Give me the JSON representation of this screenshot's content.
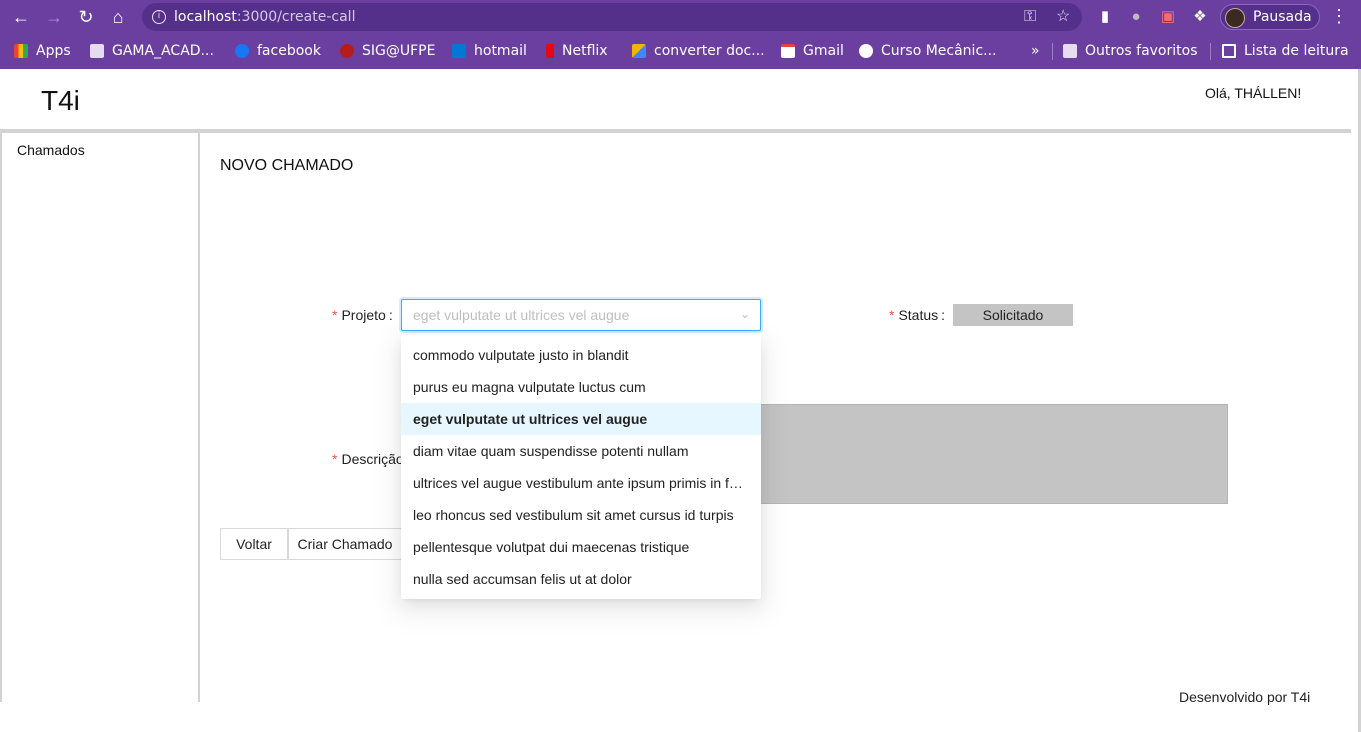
{
  "browser": {
    "url_host": "localhost",
    "url_path": ":3000/create-call",
    "profile_label": "Pausada",
    "bookmarks": [
      {
        "label": "Apps",
        "icon": "apps-grid-icon",
        "color": "#ea4335"
      },
      {
        "label": "GAMA_ACAD...",
        "icon": "folder-icon",
        "color": "#e6dcf2"
      },
      {
        "label": "facebook",
        "icon": "facebook-icon",
        "color": "#1877f2"
      },
      {
        "label": "SIG@UFPE",
        "icon": "sig-icon",
        "color": "#b71c1c"
      },
      {
        "label": "hotmail",
        "icon": "outlook-icon",
        "color": "#0078d4"
      },
      {
        "label": "Netflix",
        "icon": "netflix-icon",
        "color": "#e50914"
      },
      {
        "label": "converter doc...",
        "icon": "converter-icon",
        "color": "#f4b400"
      },
      {
        "label": "Gmail",
        "icon": "gmail-icon",
        "color": "#ea4335"
      },
      {
        "label": "Curso Mecânic...",
        "icon": "course-icon",
        "color": "#ffffff"
      },
      {
        "label": "»",
        "icon": "chevrons-icon",
        "color": "#ffffff"
      },
      {
        "label": "Outros favoritos",
        "icon": "folder-icon",
        "color": "#e6dcf2"
      },
      {
        "label": "Lista de leitura",
        "icon": "reading-list-icon",
        "color": "#ffffff"
      }
    ]
  },
  "header": {
    "logo": "T4i",
    "greeting": "Olá, THÁLLEN!"
  },
  "sidebar": {
    "items": [
      {
        "label": "Chamados"
      }
    ]
  },
  "form": {
    "title": "NOVO CHAMADO",
    "project_label": "Projeto",
    "project_value": "eget vulputate ut ultrices vel augue",
    "status_label": "Status",
    "status_value": "Solicitado",
    "description_label": "Descrição",
    "back_label": "Voltar",
    "create_label": "Criar Chamado"
  },
  "dropdown": {
    "options": [
      "commodo vulputate justo in blandit",
      "purus eu magna vulputate luctus cum",
      "eget vulputate ut ultrices vel augue",
      "diam vitae quam suspendisse potenti nullam",
      "ultrices vel augue vestibulum ante ipsum primis in faucibus",
      "leo rhoncus sed vestibulum sit amet cursus id turpis",
      "pellentesque volutpat dui maecenas tristique",
      "nulla sed accumsan felis ut at dolor"
    ],
    "selected_index": 2
  },
  "footer": {
    "text": "Desenvolvido por T4i"
  }
}
